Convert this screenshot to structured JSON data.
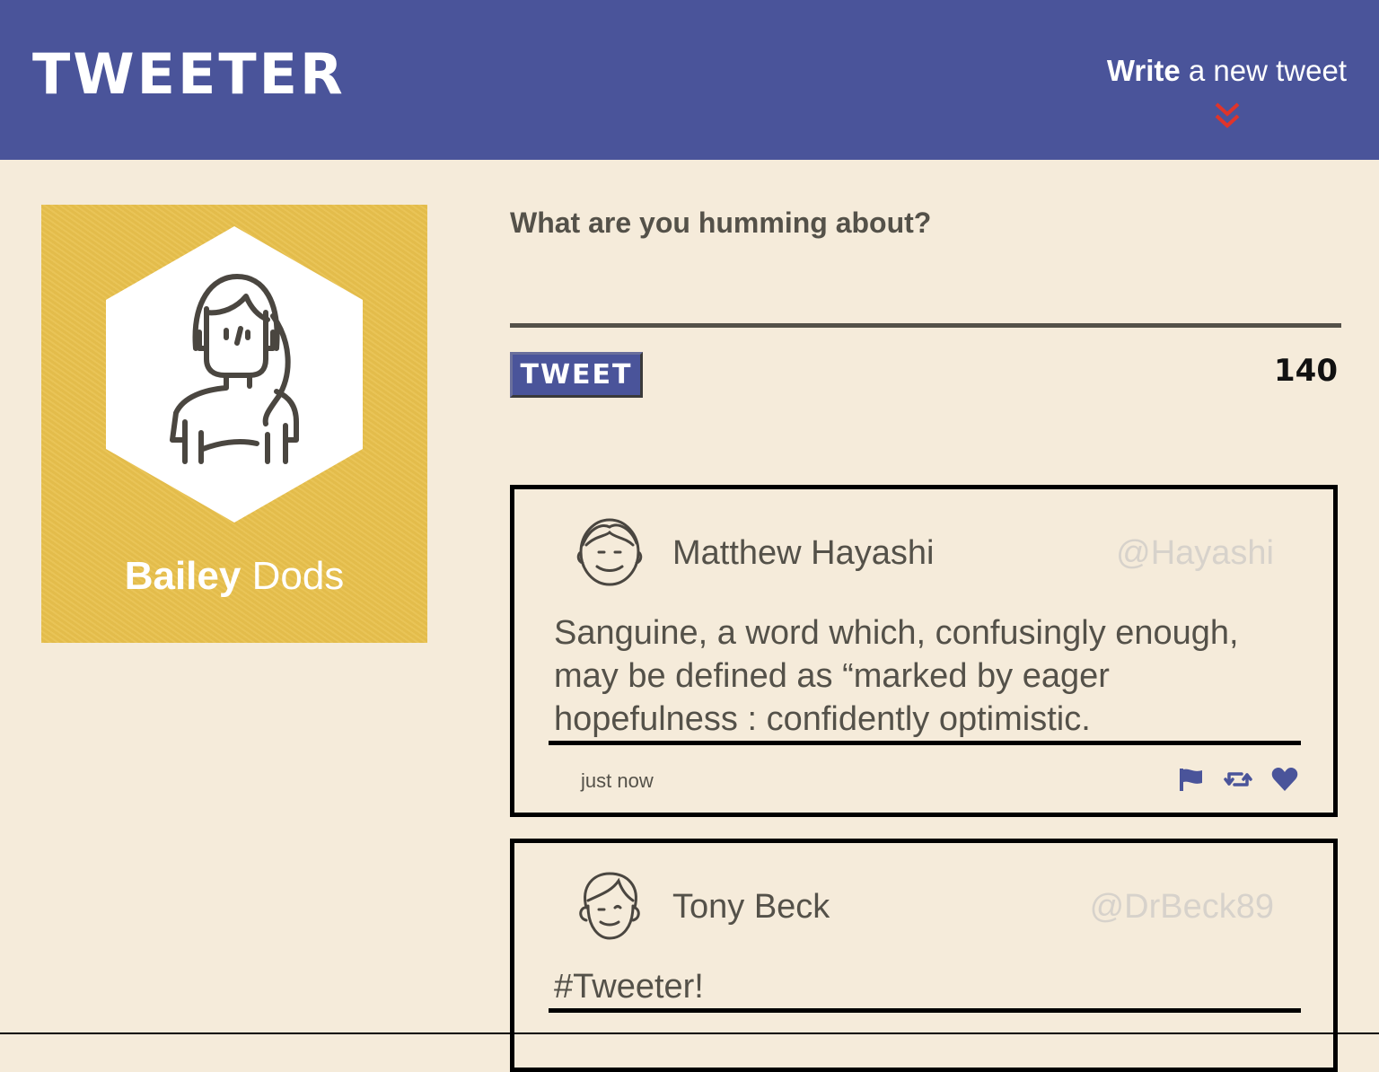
{
  "nav": {
    "brand": "TWEETER",
    "compose_bold": "Write",
    "compose_rest": " a new tweet",
    "brand_color": "#4a549a",
    "chevron_color": "#e0342a"
  },
  "profile": {
    "first_name": "Bailey",
    "last_name": " Dods",
    "card_color": "#e8c04d"
  },
  "composer": {
    "prompt": "What are you humming about?",
    "text": "",
    "button_label": "TWEET",
    "counter": "140"
  },
  "tweets": [
    {
      "name": "Matthew Hayashi",
      "handle": "@Hayashi",
      "text": "Sanguine, a word which, confusingly enough, may be defined as “marked by eager hopefulness : confidently optimistic.",
      "time": "just now",
      "actions": [
        "flag-icon",
        "retweet-icon",
        "heart-icon"
      ]
    },
    {
      "name": "Tony Beck",
      "handle": "@DrBeck89",
      "text": "#Tweeter!"
    }
  ]
}
